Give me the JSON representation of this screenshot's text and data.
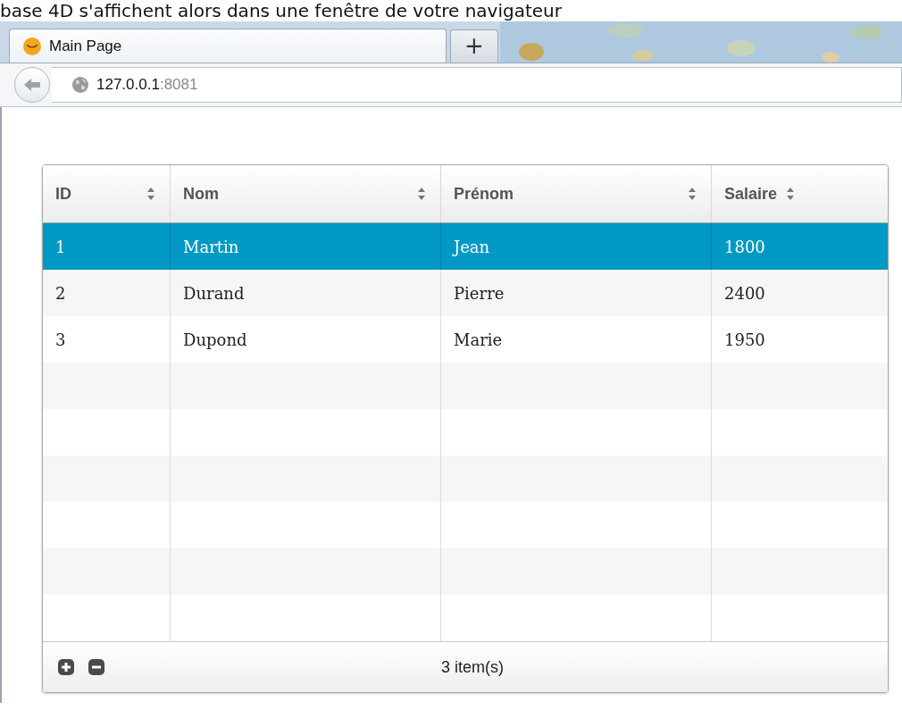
{
  "caption": "base 4D s'affichent alors dans une fenêtre de votre navigateur",
  "browser": {
    "tab": {
      "title": "Main Page"
    },
    "new_tab": "+",
    "address": {
      "host": "127.0.0.1",
      "port": ":8081"
    }
  },
  "table": {
    "columns": [
      "ID",
      "Nom",
      "Prénom",
      "Salaire"
    ],
    "rows": [
      {
        "cells": [
          "1",
          "Martin",
          "Jean",
          "1800"
        ],
        "selected": true
      },
      {
        "cells": [
          "2",
          "Durand",
          "Pierre",
          "2400"
        ],
        "selected": false
      },
      {
        "cells": [
          "3",
          "Dupond",
          "Marie",
          "1950"
        ],
        "selected": false
      }
    ],
    "footer": {
      "count": "3 item(s)"
    }
  }
}
